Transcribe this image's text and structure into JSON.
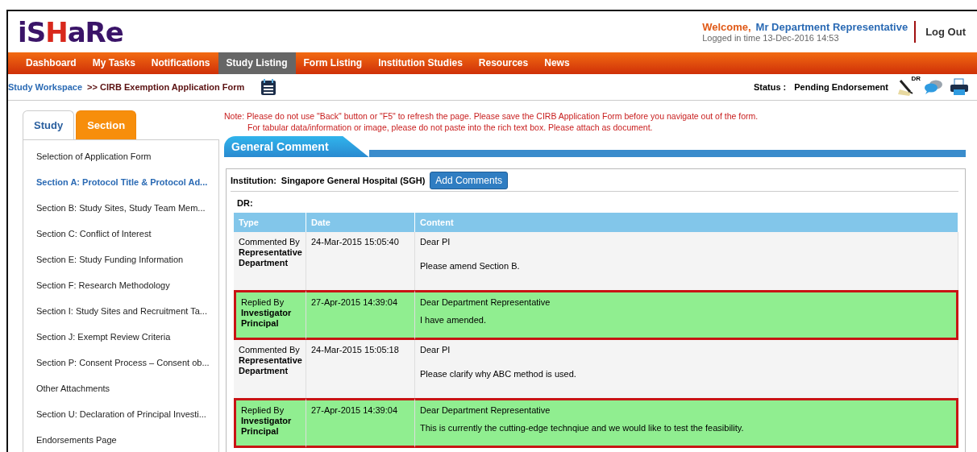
{
  "header": {
    "logo": [
      {
        "text": "iS",
        "kind": "plain"
      },
      {
        "text": "H",
        "kind": "accent"
      },
      {
        "text": "aRe",
        "kind": "plain"
      }
    ],
    "welcome": "Welcome,",
    "user": "Mr Department Representative",
    "login_time": "Logged in time 13-Dec-2016 14:53",
    "logout": "Log Out"
  },
  "nav": [
    {
      "label": "Dashboard",
      "selected": false
    },
    {
      "label": "My Tasks",
      "selected": false
    },
    {
      "label": "Notifications",
      "selected": false
    },
    {
      "label": "Study Listing",
      "selected": true
    },
    {
      "label": "Form Listing",
      "selected": false
    },
    {
      "label": "Institution Studies",
      "selected": false
    },
    {
      "label": "Resources",
      "selected": false
    },
    {
      "label": "News",
      "selected": false
    }
  ],
  "breadcrumb": {
    "link": "Study Workspace",
    "current": ">> CIRB Exemption Application Form",
    "status_label": "Status :",
    "status": "Pending Endorsement",
    "signer_badge": "DR"
  },
  "sidebar": {
    "tabs": [
      {
        "label": "Study",
        "selected": false
      },
      {
        "label": "Section",
        "selected": true
      }
    ],
    "items": [
      {
        "label": "Selection of Application Form",
        "selected": false
      },
      {
        "label": "Section A: Protocol Title & Protocol Ad...",
        "selected": true
      },
      {
        "label": "Section B: Study Sites, Study Team Mem...",
        "selected": false
      },
      {
        "label": "Section C: Conflict of Interest",
        "selected": false
      },
      {
        "label": "Section E: Study Funding Information",
        "selected": false
      },
      {
        "label": "Section F: Research Methodology",
        "selected": false
      },
      {
        "label": "Section I: Study Sites and Recruitment Ta...",
        "selected": false
      },
      {
        "label": "Section J: Exempt Review Criteria",
        "selected": false
      },
      {
        "label": "Section P: Consent Process – Consent ob...",
        "selected": false
      },
      {
        "label": "Other Attachments",
        "selected": false
      },
      {
        "label": "Section U: Declaration of Principal Investi...",
        "selected": false
      },
      {
        "label": "Endorsements Page",
        "selected": false
      }
    ]
  },
  "notes": [
    "Note: Please do not use \"Back\" button or \"F5\" to refresh the page. Please save the CIRB Application Form before you navigate out of the form.",
    "For tabular data/information or image, please do not paste into the rich text box. Please attach as document."
  ],
  "panel": {
    "title": "General Comment",
    "institution_label": "Institution:",
    "institution": "Singapore General Hospital (SGH)",
    "add_button": "Add Comments",
    "group": "DR:",
    "columns": [
      "Type",
      "Date",
      "Content"
    ],
    "rows": [
      {
        "kind": "comment",
        "action": "Commented By",
        "by": [
          "Representative",
          "Department"
        ],
        "date": "24-Mar-2015 15:05:40",
        "content": [
          "Dear PI",
          "Please amend Section B."
        ]
      },
      {
        "kind": "reply",
        "action": "Replied By",
        "by": [
          "Investigator",
          "Principal"
        ],
        "date": "27-Apr-2015 14:39:04",
        "content": [
          "Dear Department Representative",
          "I have amended."
        ]
      },
      {
        "kind": "comment",
        "action": "Commented By",
        "by": [
          "Representative",
          "Department"
        ],
        "date": "24-Mar-2015 15:05:18",
        "content": [
          "Dear PI",
          "Please clarify why ABC method is used."
        ]
      },
      {
        "kind": "reply",
        "action": "Replied By",
        "by": [
          "Investigator",
          "Principal"
        ],
        "date": "27-Apr-2015 14:39:04",
        "content": [
          "Dear Department Representative",
          "This is currently the cutting-edge technqiue and we would like to test the feasibility."
        ]
      }
    ]
  }
}
